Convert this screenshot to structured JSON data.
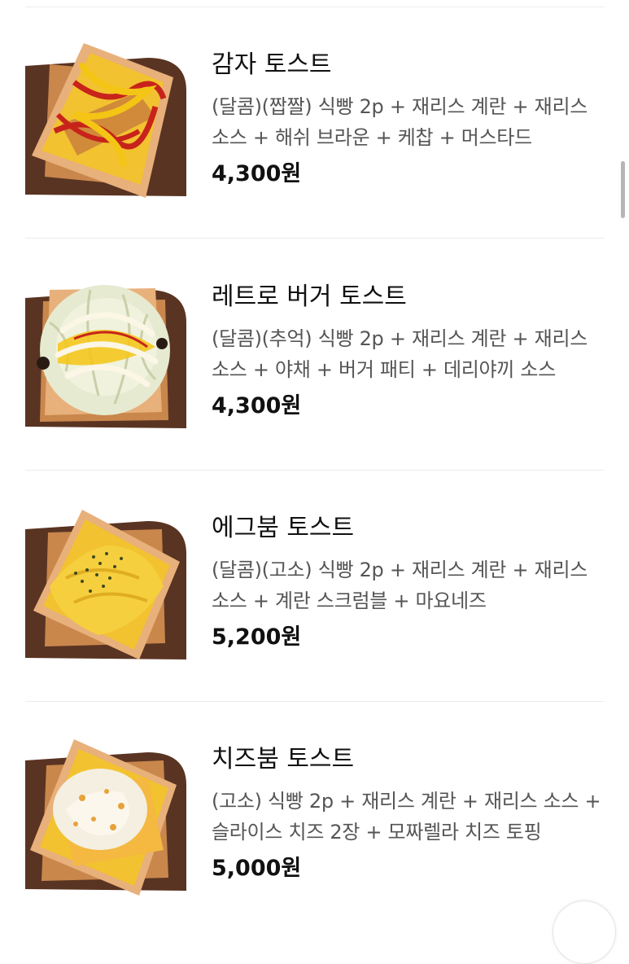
{
  "currency_suffix": "원",
  "menu_items": [
    {
      "name": "감자 토스트",
      "description": "(달콤)(짭짤) 식빵 2p + 재리스 계란 + 재리스 소스 + 해쉬 브라운 + 케찹 + 머스타드",
      "price": "4,300원",
      "image": "potato-toast-photo"
    },
    {
      "name": "레트로 버거 토스트",
      "description": "(달콤)(추억) 식빵 2p + 재리스 계란 + 재리스 소스 + 야채 + 버거 패티 + 데리야끼 소스",
      "price": "4,300원",
      "image": "retro-burger-toast-photo"
    },
    {
      "name": "에그붐 토스트",
      "description": "(달콤)(고소) 식빵 2p + 재리스 계란 + 재리스 소스 + 계란 스크럼블 + 마요네즈",
      "price": "5,200원",
      "image": "egg-boom-toast-photo"
    },
    {
      "name": "치즈붐 토스트",
      "description": "(고소) 식빵 2p + 재리스 계란 + 재리스 소스 + 슬라이스 치즈 2장 + 모짜렐라 치즈 토핑",
      "price": "5,000원",
      "image": "cheese-boom-toast-photo"
    }
  ],
  "colors": {
    "board": "#5a3422",
    "bread": "#e8b07a",
    "crust": "#c9874c",
    "egg": "#f2c230",
    "ketchup": "#c8231b",
    "mustard": "#f4c514",
    "cabbage": "#e6ead0",
    "cheese": "#f5b840",
    "mozzarella": "#f4efe0"
  },
  "scroll_icon": "floating-circle-button"
}
